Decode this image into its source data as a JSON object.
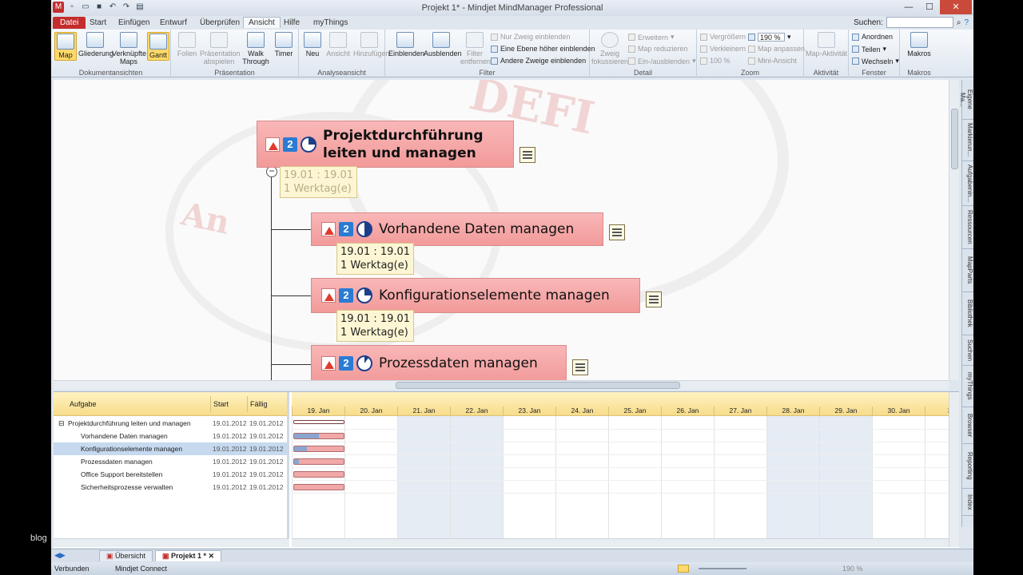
{
  "window": {
    "title": "Projekt 1* - Mindjet MindManager Professional"
  },
  "watermark": {
    "text": "blog"
  },
  "tabs": [
    "Datei",
    "Start",
    "Einfügen",
    "Entwurf",
    "Überprüfen",
    "Ansicht",
    "Hilfe",
    "myThings"
  ],
  "search": {
    "label": "Suchen:",
    "value": ""
  },
  "ribbon": {
    "groups": {
      "dokumentansichten": "Dokumentansichten",
      "praesentation": "Präsentation",
      "analyseansicht": "Analyseansicht",
      "filter": "Filter",
      "detail": "Detail",
      "zoom": "Zoom",
      "aktivitaet": "Aktivität",
      "fenster": "Fenster",
      "makros": "Makros"
    },
    "buttons": {
      "map": "Map",
      "gliederung": "Gliederung",
      "verknuepfte": "Verknüpfte Maps",
      "gantt": "Gantt",
      "folien": "Folien",
      "praesentation_abspielen": "Präsentation abspielen",
      "walk": "Walk Through",
      "timer": "Timer",
      "neu": "Neu",
      "ansicht": "Ansicht",
      "hinzufuegen": "Hinzufügen",
      "einblenden": "Einblenden",
      "ausblenden": "Ausblenden",
      "filter_entfernen": "Filter entfernen",
      "nur_zweig": "Nur Zweig einblenden",
      "eine_ebene": "Eine Ebene höher einblenden",
      "andere_zweige": "Andere Zweige einblenden",
      "zweig_fokussieren": "Zweig fokussieren",
      "erweitern": "Erweitern",
      "map_reduzieren": "Map reduzieren",
      "ein_ausblenden": "Ein-/ausblenden",
      "vergroessern": "Vergrößern",
      "verkleinern": "Verkleinern",
      "zoom_100": "100 %",
      "zoom_level": "190 %",
      "map_anpassen": "Map anpassen",
      "mini_ansicht": "Mini-Ansicht",
      "map_aktivitaet": "Map-Aktivität",
      "anordnen": "Anordnen",
      "teilen": "Teilen",
      "wechseln": "Wechseln",
      "makros": "Makros"
    }
  },
  "right_pane_tabs": [
    "Eigene Ma...",
    "Markierun...",
    "Aufgabenin...",
    "Ressourcen",
    "MapParts",
    "Bibliothek",
    "Suchen",
    "myThings",
    "Browser",
    "Reporting",
    "Index"
  ],
  "map": {
    "central": {
      "title_line1": "Projektdurchführung",
      "title_line2": "leiten und managen",
      "priority": "2",
      "dates": "19.01 : 19.01",
      "duration": "1 Werktag(e)"
    },
    "subtopics": [
      {
        "title": "Vorhandene Daten managen",
        "priority": "2",
        "dates": "19.01 : 19.01",
        "duration": "1 Werktag(e)"
      },
      {
        "title": "Konfigurationselemente managen",
        "priority": "2",
        "dates": "19.01 : 19.01",
        "duration": "1 Werktag(e)"
      },
      {
        "title": "Prozessdaten managen",
        "priority": "2"
      }
    ],
    "background_text": [
      "DEFI",
      "An"
    ]
  },
  "gantt": {
    "headers": {
      "task": "Aufgabe",
      "start": "Start",
      "due": "Fällig"
    },
    "rows": [
      {
        "name": "Projektdurchführung leiten und managen",
        "start": "19.01.2012",
        "due": "19.01.2012",
        "progress": 0
      },
      {
        "name": "Vorhandene Daten managen",
        "start": "19.01.2012",
        "due": "19.01.2012",
        "progress": 50
      },
      {
        "name": "Konfigurationselemente managen",
        "start": "19.01.2012",
        "due": "19.01.2012",
        "progress": 25
      },
      {
        "name": "Prozessdaten managen",
        "start": "19.01.2012",
        "due": "19.01.2012",
        "progress": 10
      },
      {
        "name": "Office Support bereitstellen",
        "start": "19.01.2012",
        "due": "19.01.2012",
        "progress": 0
      },
      {
        "name": "Sicherheitsprozesse verwalten",
        "start": "19.01.2012",
        "due": "19.01.2012",
        "progress": 0
      }
    ],
    "days": [
      "19. Jan",
      "20. Jan",
      "21. Jan",
      "22. Jan",
      "23. Jan",
      "24. Jan",
      "25. Jan",
      "26. Jan",
      "27. Jan",
      "28. Jan",
      "29. Jan",
      "30. Jan",
      "31"
    ],
    "weekend": [
      2,
      3,
      9,
      10
    ]
  },
  "doc_tabs": [
    "Übersicht",
    "Projekt 1 *"
  ],
  "status": {
    "verbunden": "Verbunden",
    "connect": "Mindjet Connect",
    "zoom": "190 %"
  }
}
